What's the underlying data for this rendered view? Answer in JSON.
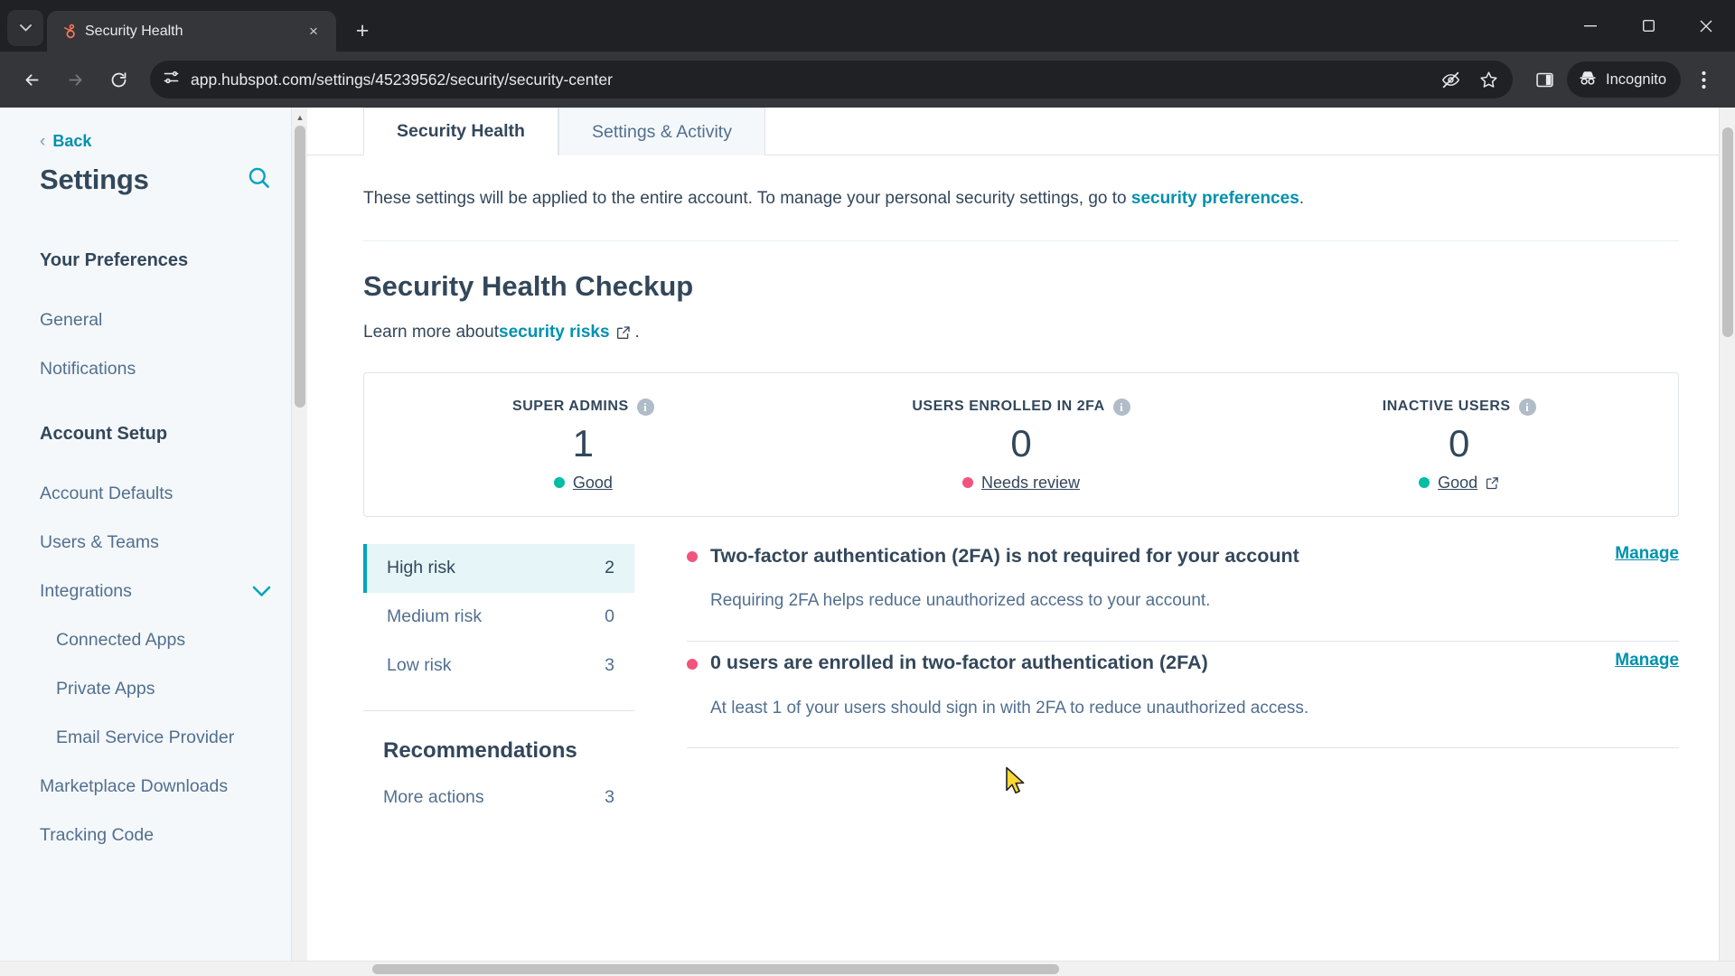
{
  "browser": {
    "tab": {
      "title": "Security Health",
      "favicon": "hubspot-sprocket-icon"
    },
    "new_tab_label": "+",
    "close_tab_label": "×",
    "url": "app.hubspot.com/settings/45239562/security/security-center",
    "incognito_label": "Incognito",
    "window_controls": {
      "minimize": "−",
      "maximize": "□",
      "close": "✕"
    }
  },
  "sidebar": {
    "back_label": "Back",
    "title": "Settings",
    "groups": [
      {
        "title": "Your Preferences",
        "items": [
          {
            "label": "General",
            "sub": false,
            "chevron": false
          },
          {
            "label": "Notifications",
            "sub": false,
            "chevron": false
          }
        ]
      },
      {
        "title": "Account Setup",
        "items": [
          {
            "label": "Account Defaults",
            "sub": false,
            "chevron": false
          },
          {
            "label": "Users & Teams",
            "sub": false,
            "chevron": false
          },
          {
            "label": "Integrations",
            "sub": false,
            "chevron": true
          },
          {
            "label": "Connected Apps",
            "sub": true,
            "chevron": false
          },
          {
            "label": "Private Apps",
            "sub": true,
            "chevron": false
          },
          {
            "label": "Email Service Provider",
            "sub": true,
            "chevron": false
          },
          {
            "label": "Marketplace Downloads",
            "sub": false,
            "chevron": false
          },
          {
            "label": "Tracking Code",
            "sub": false,
            "chevron": false
          }
        ]
      }
    ]
  },
  "main": {
    "tabs": [
      {
        "label": "Security Health",
        "active": true
      },
      {
        "label": "Settings & Activity",
        "active": false
      }
    ],
    "intro_prefix": "These settings will be applied to the entire account. To manage your personal security settings, go to ",
    "intro_link": "security preferences",
    "intro_suffix": ".",
    "heading": "Security Health Checkup",
    "learn_prefix": "Learn more about ",
    "learn_link": "security risks",
    "learn_suffix": ".",
    "cards": [
      {
        "label": "SUPER ADMINS",
        "value": "1",
        "status": "Good",
        "status_color": "#00bda5",
        "external": false
      },
      {
        "label": "USERS ENROLLED IN 2FA",
        "value": "0",
        "status": "Needs review",
        "status_color": "#f2547d",
        "external": false
      },
      {
        "label": "INACTIVE USERS",
        "value": "0",
        "status": "Good",
        "status_color": "#00bda5",
        "external": true
      }
    ],
    "risk_nav": [
      {
        "label": "High risk",
        "count": "2",
        "active": true
      },
      {
        "label": "Medium risk",
        "count": "0",
        "active": false
      },
      {
        "label": "Low risk",
        "count": "3",
        "active": false
      }
    ],
    "recommendations_title": "Recommendations",
    "recommendations": [
      {
        "label": "More actions",
        "count": "3"
      }
    ],
    "risk_items": [
      {
        "title": "Two-factor authentication (2FA) is not required for your account",
        "description": "Requiring 2FA helps reduce unauthorized access to your account.",
        "action": "Manage",
        "dot_color": "#f2547d"
      },
      {
        "title": "0 users are enrolled in two-factor authentication (2FA)",
        "description": "At least 1 of your users should sign in with 2FA to reduce unauthorized access.",
        "action": "Manage",
        "dot_color": "#f2547d"
      }
    ]
  },
  "colors": {
    "accent_teal": "#00a4bd",
    "link_teal": "#0091ae",
    "text_dark": "#33475b",
    "text_muted": "#516f90",
    "good_green": "#00bda5",
    "risk_red": "#f2547d",
    "selected_bg": "#e5f5f8"
  }
}
